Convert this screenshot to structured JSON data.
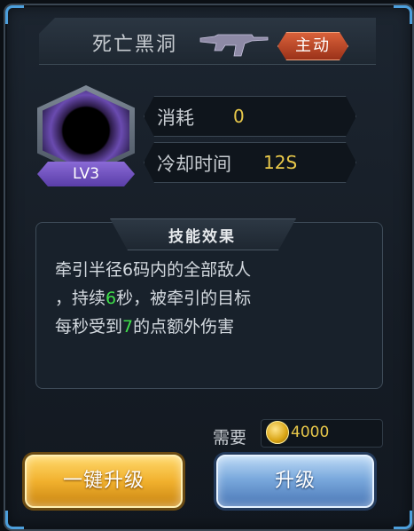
{
  "skill": {
    "name": "死亡黑洞",
    "type_badge": "主动",
    "level": "LV3"
  },
  "stats": {
    "cost_label": "消耗",
    "cost_value": "0",
    "cooldown_label": "冷却时间",
    "cooldown_value": "12S"
  },
  "effect": {
    "title": "技能效果",
    "text_1": "牵引半径6码内的全部敌人",
    "text_2a": "，持续",
    "text_2_num": "6",
    "text_2b": "秒，被牵引的目标",
    "text_3a": "每秒受到",
    "text_3_num": "7",
    "text_3b": "的点额外伤害"
  },
  "upgrade": {
    "need_label": "需要",
    "cost": "4000",
    "one_click_label": "一键升级",
    "upgrade_label": "升级"
  },
  "colors": {
    "accent_blue": "#58b8ff",
    "value_gold": "#e8c84a",
    "highlight_green": "#3fe04a",
    "badge_orange": "#d9613a",
    "level_purple": "#7a5bc8"
  },
  "icons": {
    "weapon": "rifle-icon",
    "coin": "gold-coin-icon",
    "skill": "black-hole-icon"
  }
}
